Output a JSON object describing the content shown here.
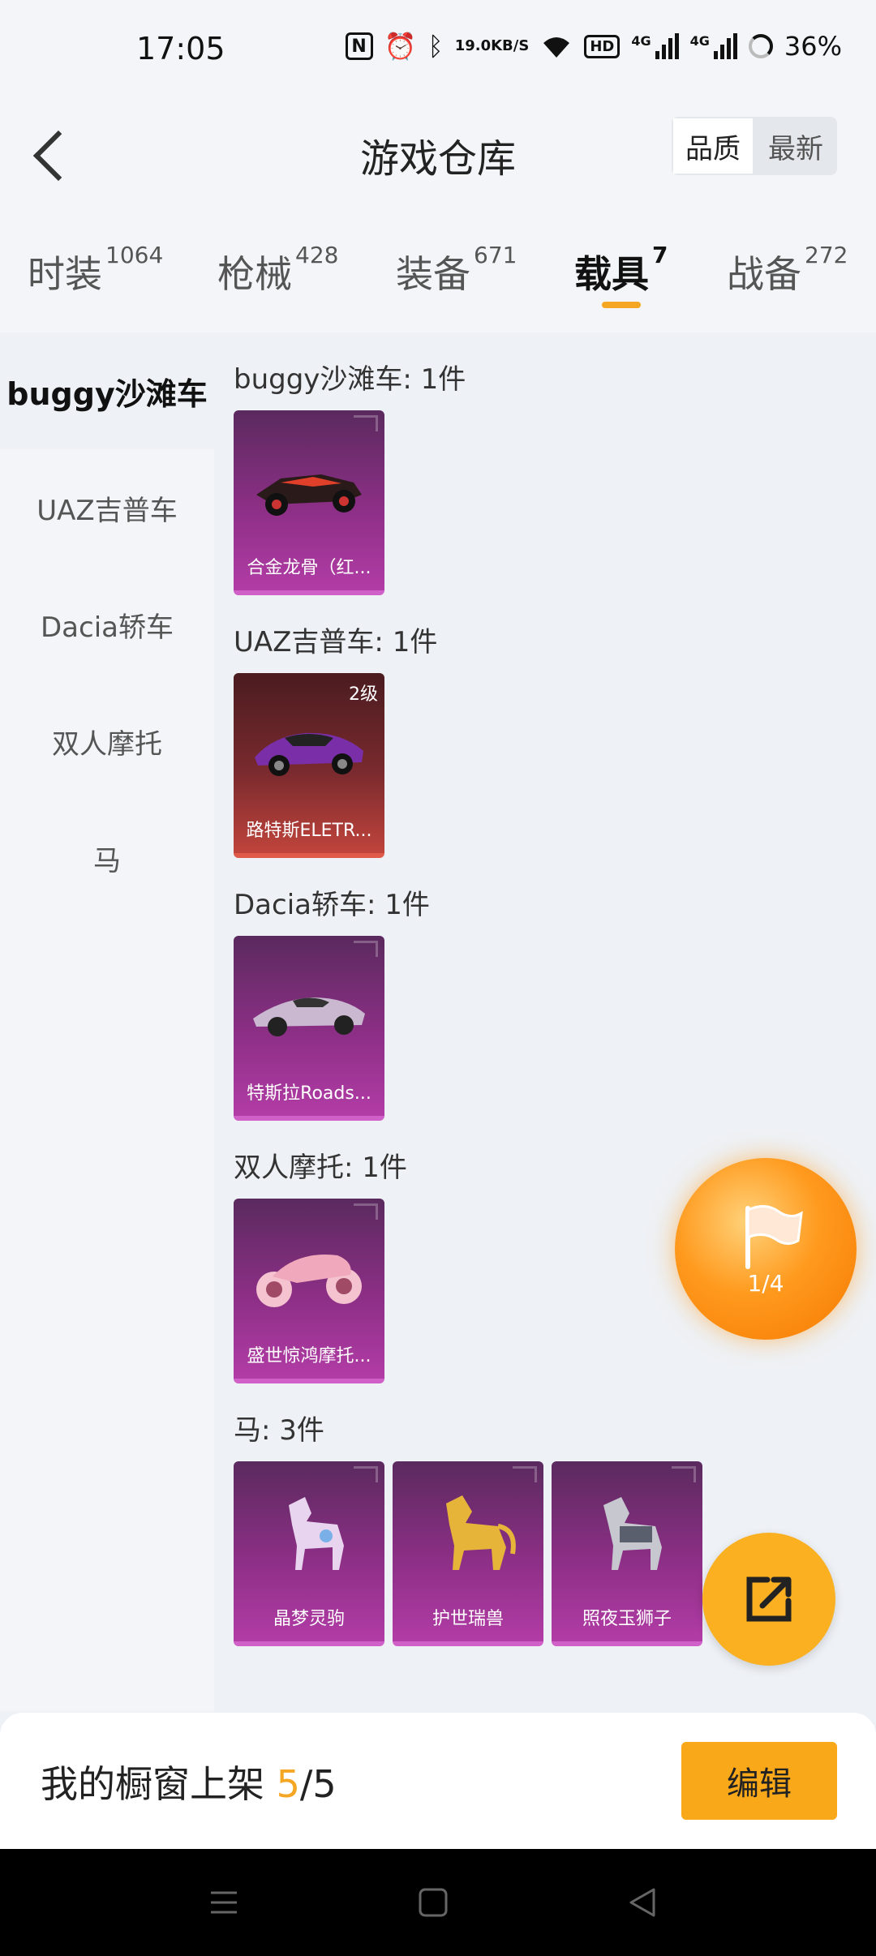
{
  "status_bar": {
    "time": "17:05",
    "speed_value": "19.0",
    "speed_unit": "KB/S",
    "hd_label": "HD",
    "net_label": "4G",
    "battery": "36%"
  },
  "header": {
    "title": "游戏仓库",
    "sort_options": [
      "品质",
      "最新"
    ],
    "sort_selected": "品质"
  },
  "tabs": [
    {
      "label": "时装",
      "count": "1064"
    },
    {
      "label": "枪械",
      "count": "428"
    },
    {
      "label": "装备",
      "count": "671"
    },
    {
      "label": "载具",
      "count": "7"
    },
    {
      "label": "战备",
      "count": "272"
    }
  ],
  "active_tab": "载具",
  "sidebar": {
    "items": [
      "buggy沙滩车",
      "UAZ吉普车",
      "Dacia轿车",
      "双人摩托",
      "马"
    ],
    "selected": "buggy沙滩车"
  },
  "sections": [
    {
      "title": "buggy沙滩车: 1件",
      "items": [
        {
          "name": "合金龙骨（红...",
          "icon": "buggy-car-icon"
        }
      ]
    },
    {
      "title": "UAZ吉普车: 1件",
      "items": [
        {
          "name": "路特斯ELETR...",
          "level": "2级",
          "icon": "sports-car-icon"
        }
      ]
    },
    {
      "title": "Dacia轿车: 1件",
      "items": [
        {
          "name": "特斯拉Roads...",
          "icon": "roadster-car-icon"
        }
      ]
    },
    {
      "title": "双人摩托: 1件",
      "items": [
        {
          "name": "盛世惊鸿摩托...",
          "icon": "motorcycle-icon"
        }
      ]
    },
    {
      "title": "马: 3件",
      "items": [
        {
          "name": "晶梦灵驹",
          "icon": "crystal-horse-icon"
        },
        {
          "name": "护世瑞兽",
          "icon": "golden-beast-icon"
        },
        {
          "name": "照夜玉狮子",
          "icon": "armored-horse-icon"
        }
      ]
    }
  ],
  "floating": {
    "orb_count": "1/4",
    "orb_icon": "flag-icon",
    "share_icon": "share-icon"
  },
  "bottom_bar": {
    "label_prefix": "我的橱窗上架 ",
    "shelf_current": "5",
    "shelf_separator": "/",
    "shelf_total": "5",
    "edit_label": "编辑"
  },
  "colors": {
    "accent": "#f5a623",
    "epic_card": "#8d2f86",
    "legendary_card": "#c0443c"
  }
}
